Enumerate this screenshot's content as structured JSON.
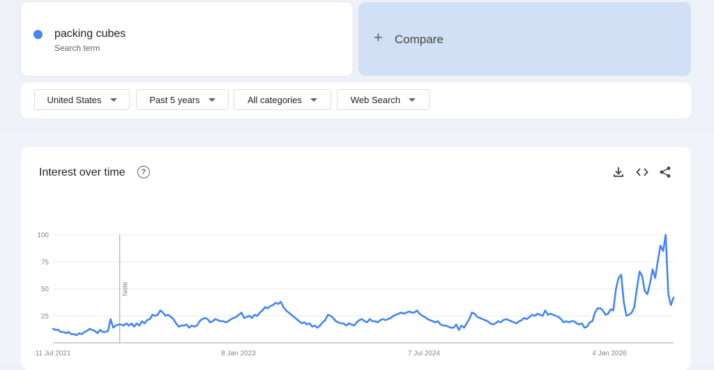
{
  "search": {
    "term": "packing cubes",
    "term_caption": "Search term",
    "term_color": "#4285f4",
    "compare_icon": "+",
    "compare_label": "Compare"
  },
  "filters": {
    "region": "United States",
    "time_range": "Past 5 years",
    "category": "All categories",
    "search_type": "Web Search"
  },
  "panel": {
    "title": "Interest over time",
    "help_icon": "?",
    "actions": [
      "download-icon",
      "embed-icon",
      "share-icon"
    ]
  },
  "chart_data": {
    "type": "line",
    "series": [
      {
        "name": "packing cubes",
        "color": "#4285f4",
        "values": [
          13,
          12,
          12,
          10,
          10,
          9,
          10,
          8,
          8,
          7,
          9,
          8,
          10,
          11,
          13,
          12,
          11,
          9,
          12,
          10,
          10,
          11,
          22,
          14,
          16,
          17,
          17,
          16,
          18,
          16,
          18,
          15,
          18,
          16,
          20,
          18,
          21,
          22,
          26,
          25,
          26,
          30,
          28,
          25,
          26,
          24,
          22,
          18,
          15,
          16,
          16,
          17,
          14,
          16,
          15,
          16,
          20,
          22,
          23,
          22,
          19,
          20,
          22,
          21,
          20,
          20,
          19,
          20,
          22,
          23,
          24,
          26,
          28,
          23,
          24,
          25,
          23,
          26,
          25,
          28,
          30,
          33,
          32,
          34,
          35,
          37,
          36,
          38,
          33,
          30,
          28,
          26,
          24,
          22,
          20,
          18,
          19,
          17,
          18,
          15,
          16,
          14,
          16,
          19,
          21,
          26,
          25,
          23,
          20,
          19,
          18,
          18,
          16,
          18,
          17,
          16,
          19,
          21,
          22,
          20,
          19,
          22,
          20,
          20,
          19,
          21,
          22,
          21,
          22,
          23,
          25,
          26,
          27,
          28,
          27,
          28,
          29,
          28,
          28,
          30,
          27,
          25,
          24,
          22,
          21,
          20,
          19,
          20,
          17,
          16,
          16,
          15,
          14,
          14,
          17,
          12,
          16,
          14,
          18,
          22,
          28,
          27,
          24,
          23,
          22,
          21,
          20,
          18,
          17,
          18,
          20,
          19,
          21,
          22,
          21,
          20,
          19,
          18,
          20,
          21,
          23,
          22,
          24,
          26,
          25,
          27,
          26,
          25,
          30,
          26,
          27,
          26,
          25,
          24,
          22,
          19,
          20,
          19,
          20,
          20,
          18,
          17,
          18,
          14,
          15,
          19,
          20,
          28,
          32,
          32,
          30,
          26,
          27,
          31,
          30,
          50,
          60,
          63,
          38,
          25,
          26,
          28,
          33,
          50,
          66,
          62,
          48,
          45,
          55,
          68,
          60,
          76,
          90,
          85,
          100,
          45,
          35,
          42
        ]
      }
    ],
    "x_start": "2021-07-11",
    "x_end": "2026-05-03",
    "x_tick_labels": [
      "11 Jul 2021",
      "8 Jan 2023",
      "7 Jul 2024",
      "4 Jan 2026"
    ],
    "y_ticks": [
      25,
      50,
      75,
      100
    ],
    "y_range": [
      0,
      100
    ],
    "annotation": {
      "label": "Note",
      "date": "2022-01-16"
    },
    "grid": true,
    "legend": "none"
  }
}
